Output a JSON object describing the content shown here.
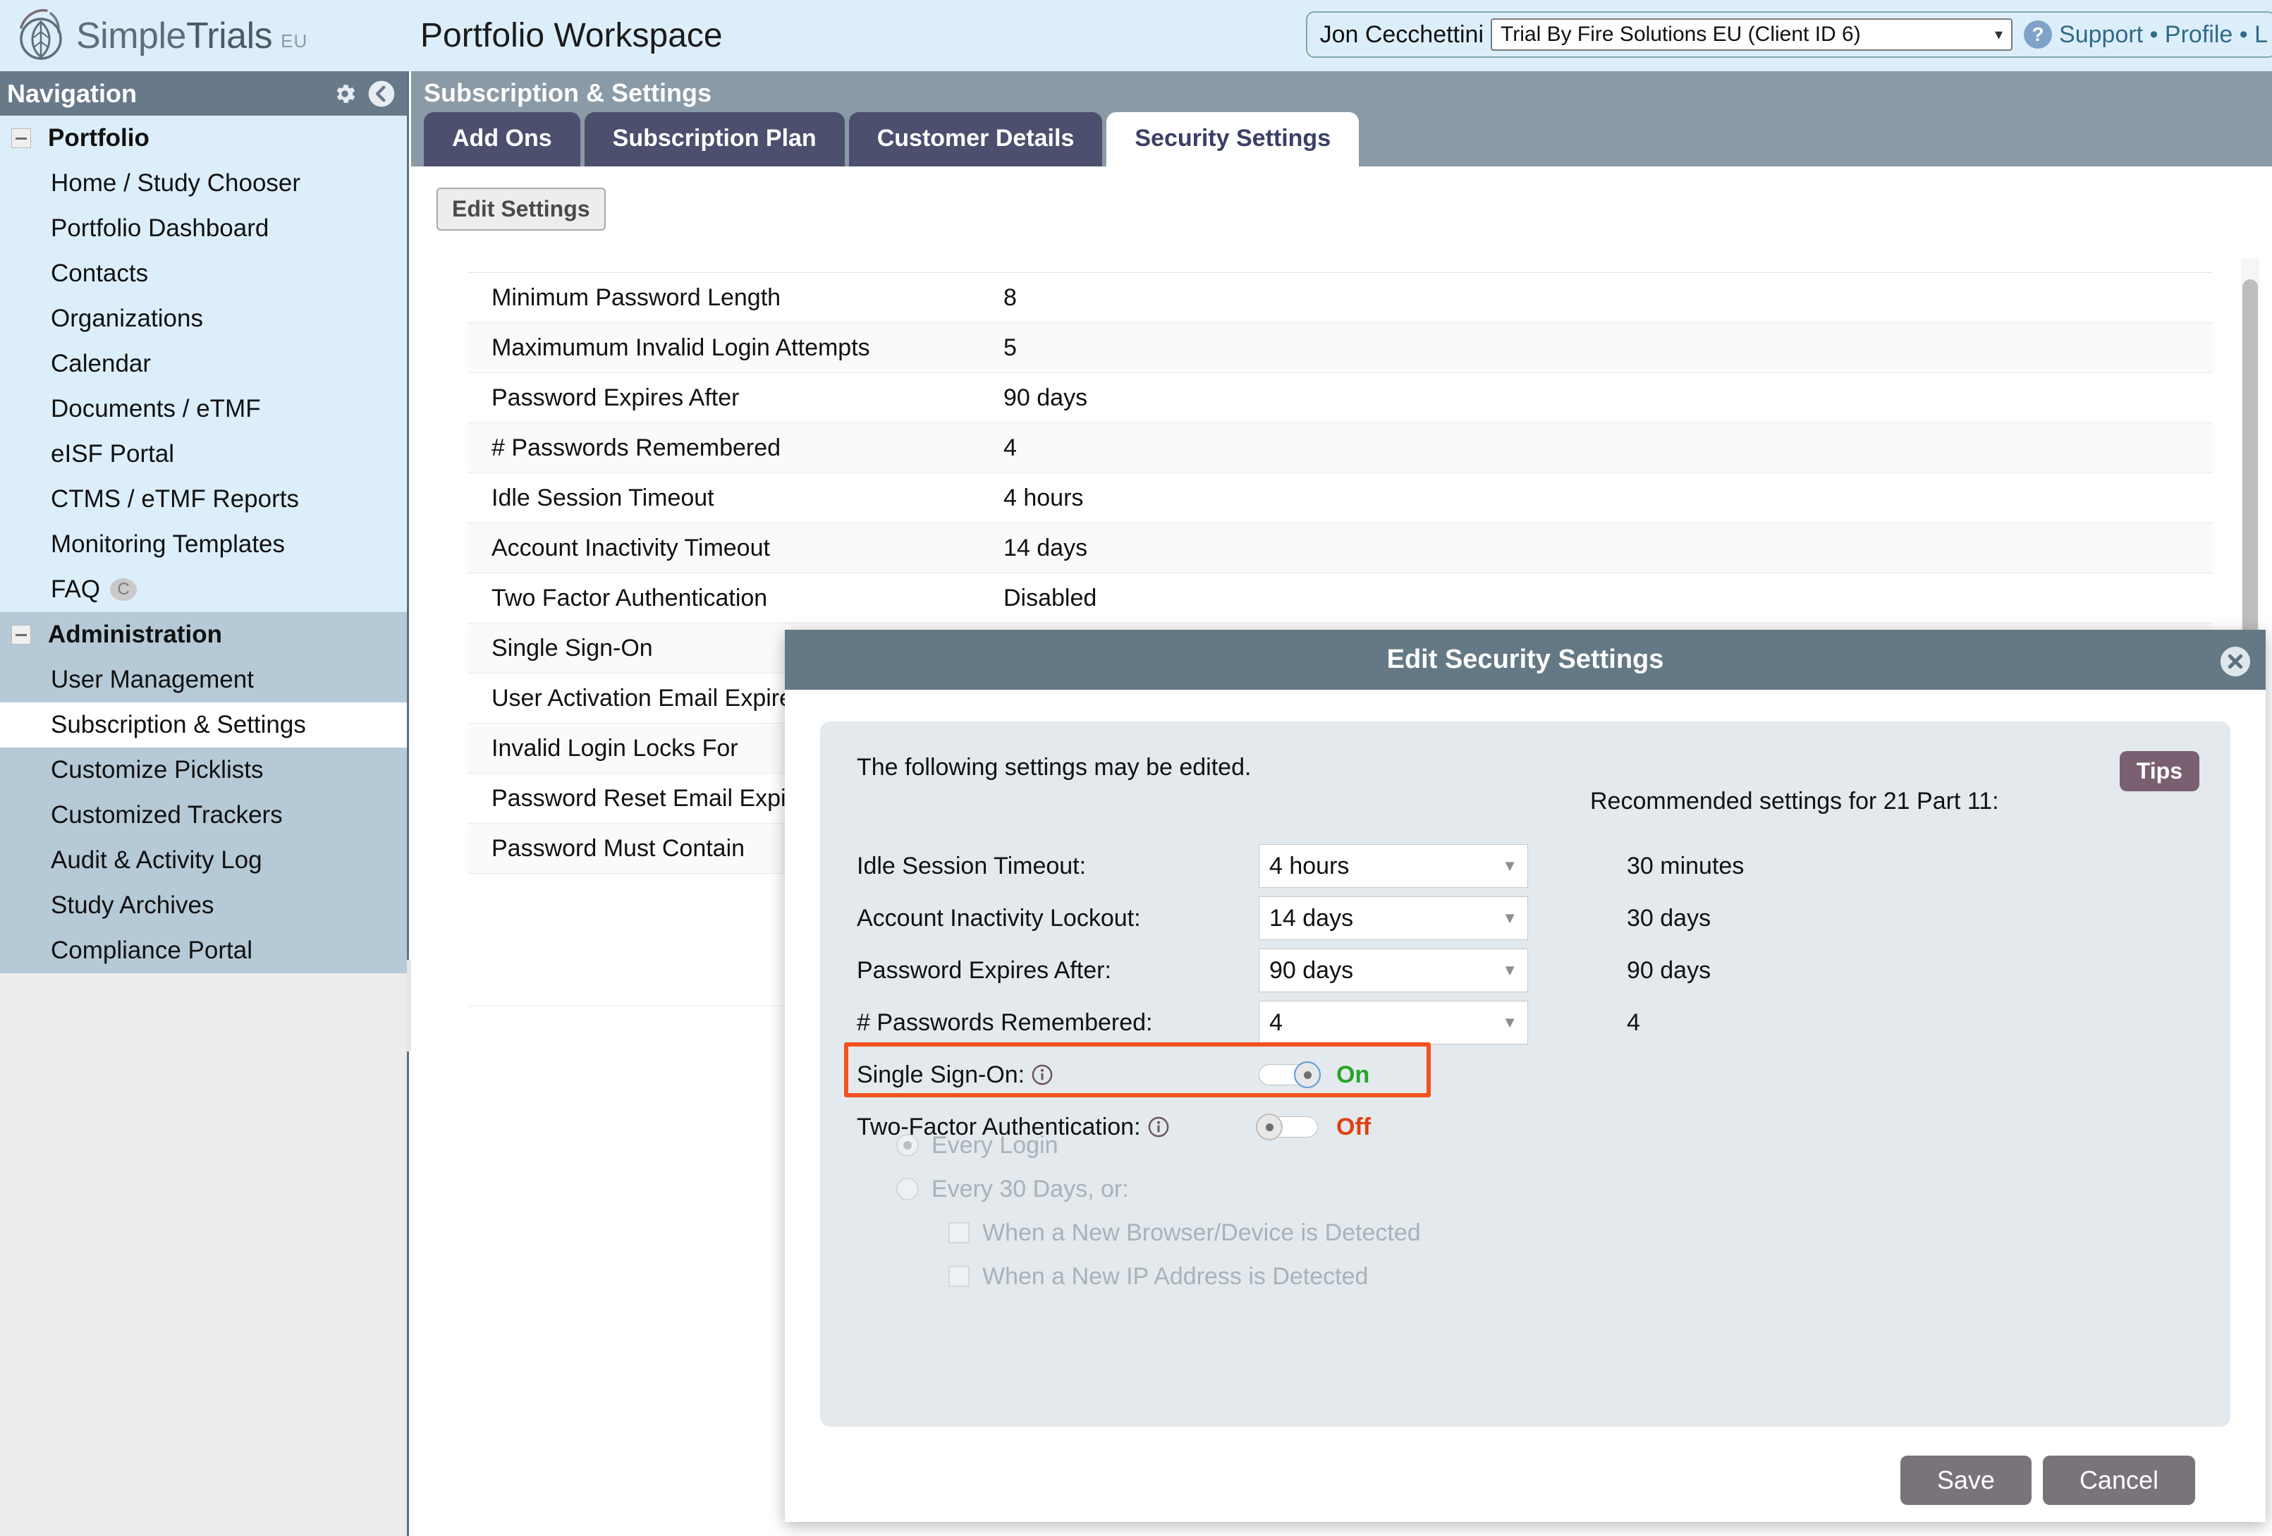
{
  "brand": {
    "name_simple": "Simple",
    "name_trials": "Trials",
    "region": "EU",
    "logo_icon": "leaf-circle-logo"
  },
  "header": {
    "page_title": "Portfolio Workspace",
    "user_name": "Jon Cecchettini",
    "client_selected": "Trial By Fire Solutions EU (Client ID 6)",
    "help_icon": "question-mark-icon",
    "links": "Support • Profile • L",
    "accent_bg": "#ddeefb"
  },
  "navigation": {
    "title": "Navigation",
    "gear_icon": "gear-icon",
    "collapse_icon": "chevron-left-circle-icon",
    "groups": [
      {
        "label": "Portfolio",
        "items": [
          {
            "label": "Home / Study Chooser"
          },
          {
            "label": "Portfolio Dashboard"
          },
          {
            "label": "Contacts"
          },
          {
            "label": "Organizations"
          },
          {
            "label": "Calendar"
          },
          {
            "label": "Documents / eTMF"
          },
          {
            "label": "eISF Portal"
          },
          {
            "label": "CTMS / eTMF Reports"
          },
          {
            "label": "Monitoring Templates"
          },
          {
            "label": "FAQ",
            "badge": "C"
          }
        ]
      },
      {
        "label": "Administration",
        "items": [
          {
            "label": "User Management"
          },
          {
            "label": "Subscription & Settings",
            "selected": true
          },
          {
            "label": "Customize Picklists"
          },
          {
            "label": "Customized Trackers"
          },
          {
            "label": "Audit & Activity Log"
          },
          {
            "label": "Study Archives"
          },
          {
            "label": "Compliance Portal"
          }
        ]
      }
    ]
  },
  "main": {
    "section_title": "Subscription & Settings",
    "tabs": [
      {
        "label": "Add Ons",
        "active": false
      },
      {
        "label": "Subscription Plan",
        "active": false
      },
      {
        "label": "Customer Details",
        "active": false
      },
      {
        "label": "Security Settings",
        "active": true
      }
    ],
    "edit_settings_label": "Edit Settings",
    "settings_rows": [
      {
        "label": "Minimum Password Length",
        "value": "8"
      },
      {
        "label": "Maximumum Invalid Login Attempts",
        "value": "5"
      },
      {
        "label": "Password Expires After",
        "value": "90 days"
      },
      {
        "label": "# Passwords Remembered",
        "value": "4"
      },
      {
        "label": "Idle Session Timeout",
        "value": "4 hours"
      },
      {
        "label": "Account Inactivity Timeout",
        "value": "14 days"
      },
      {
        "label": "Two Factor Authentication",
        "value": "Disabled"
      },
      {
        "label": "Single Sign-On",
        "value": ""
      },
      {
        "label": "User Activation Email Expires In",
        "value": ""
      },
      {
        "label": "Invalid Login Locks For",
        "value": ""
      },
      {
        "label": "Password Reset Email Expires In",
        "value": ""
      },
      {
        "label": "Password Must Contain",
        "value": ""
      }
    ]
  },
  "dialog": {
    "title": "Edit Security Settings",
    "close_icon": "close-circle-icon",
    "note": "The following settings may be edited.",
    "tips_label": "Tips",
    "recommended_heading": "Recommended settings for 21 Part 11:",
    "fields": [
      {
        "label": "Idle Session Timeout:",
        "value": "4 hours",
        "recommended": "30 minutes"
      },
      {
        "label": "Account Inactivity Lockout:",
        "value": "14 days",
        "recommended": "30 days"
      },
      {
        "label": "Password Expires After:",
        "value": "90 days",
        "recommended": "90 days"
      },
      {
        "label": "# Passwords Remembered:",
        "value": "4",
        "recommended": "4"
      }
    ],
    "sso": {
      "label": "Single Sign-On:",
      "info_icon": "info-circle-icon",
      "state": "On",
      "toggle": "on",
      "highlight_color": "#f4511e"
    },
    "two_factor": {
      "label": "Two-Factor Authentication:",
      "info_icon": "info-circle-icon",
      "state": "Off",
      "toggle": "off"
    },
    "two_factor_options": {
      "radios": [
        {
          "label": "Every Login",
          "checked": true
        },
        {
          "label": "Every 30 Days, or:",
          "checked": false
        }
      ],
      "checkboxes": [
        {
          "label": "When a New Browser/Device is Detected",
          "checked": false
        },
        {
          "label": "When a New IP Address is Detected",
          "checked": false
        }
      ]
    },
    "save_label": "Save",
    "cancel_label": "Cancel"
  }
}
